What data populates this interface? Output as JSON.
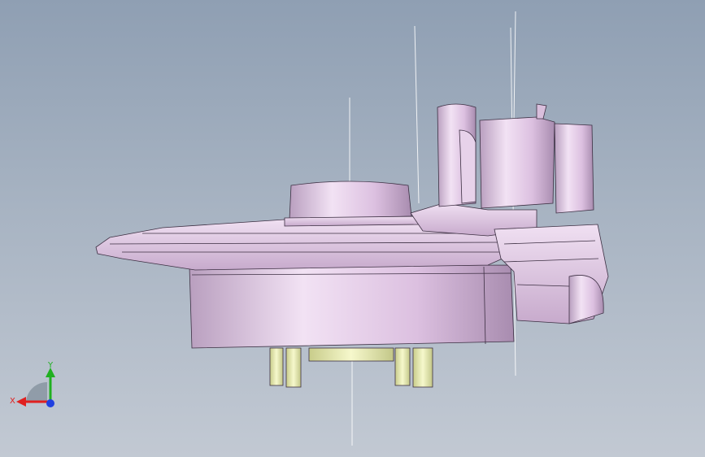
{
  "viewport": {
    "background_top": "#8f9fb3",
    "background_bottom": "#c2c9d3",
    "part_color": "#e2c8e6",
    "part_shadow": "#b79bc0",
    "pin_color": "#ebeeb4",
    "edge_color": "#3c2f42"
  },
  "triad": {
    "x_label": "X",
    "y_label": "Y",
    "x_color": "#e02020",
    "y_color": "#20b020",
    "z_color": "#2040e0"
  }
}
